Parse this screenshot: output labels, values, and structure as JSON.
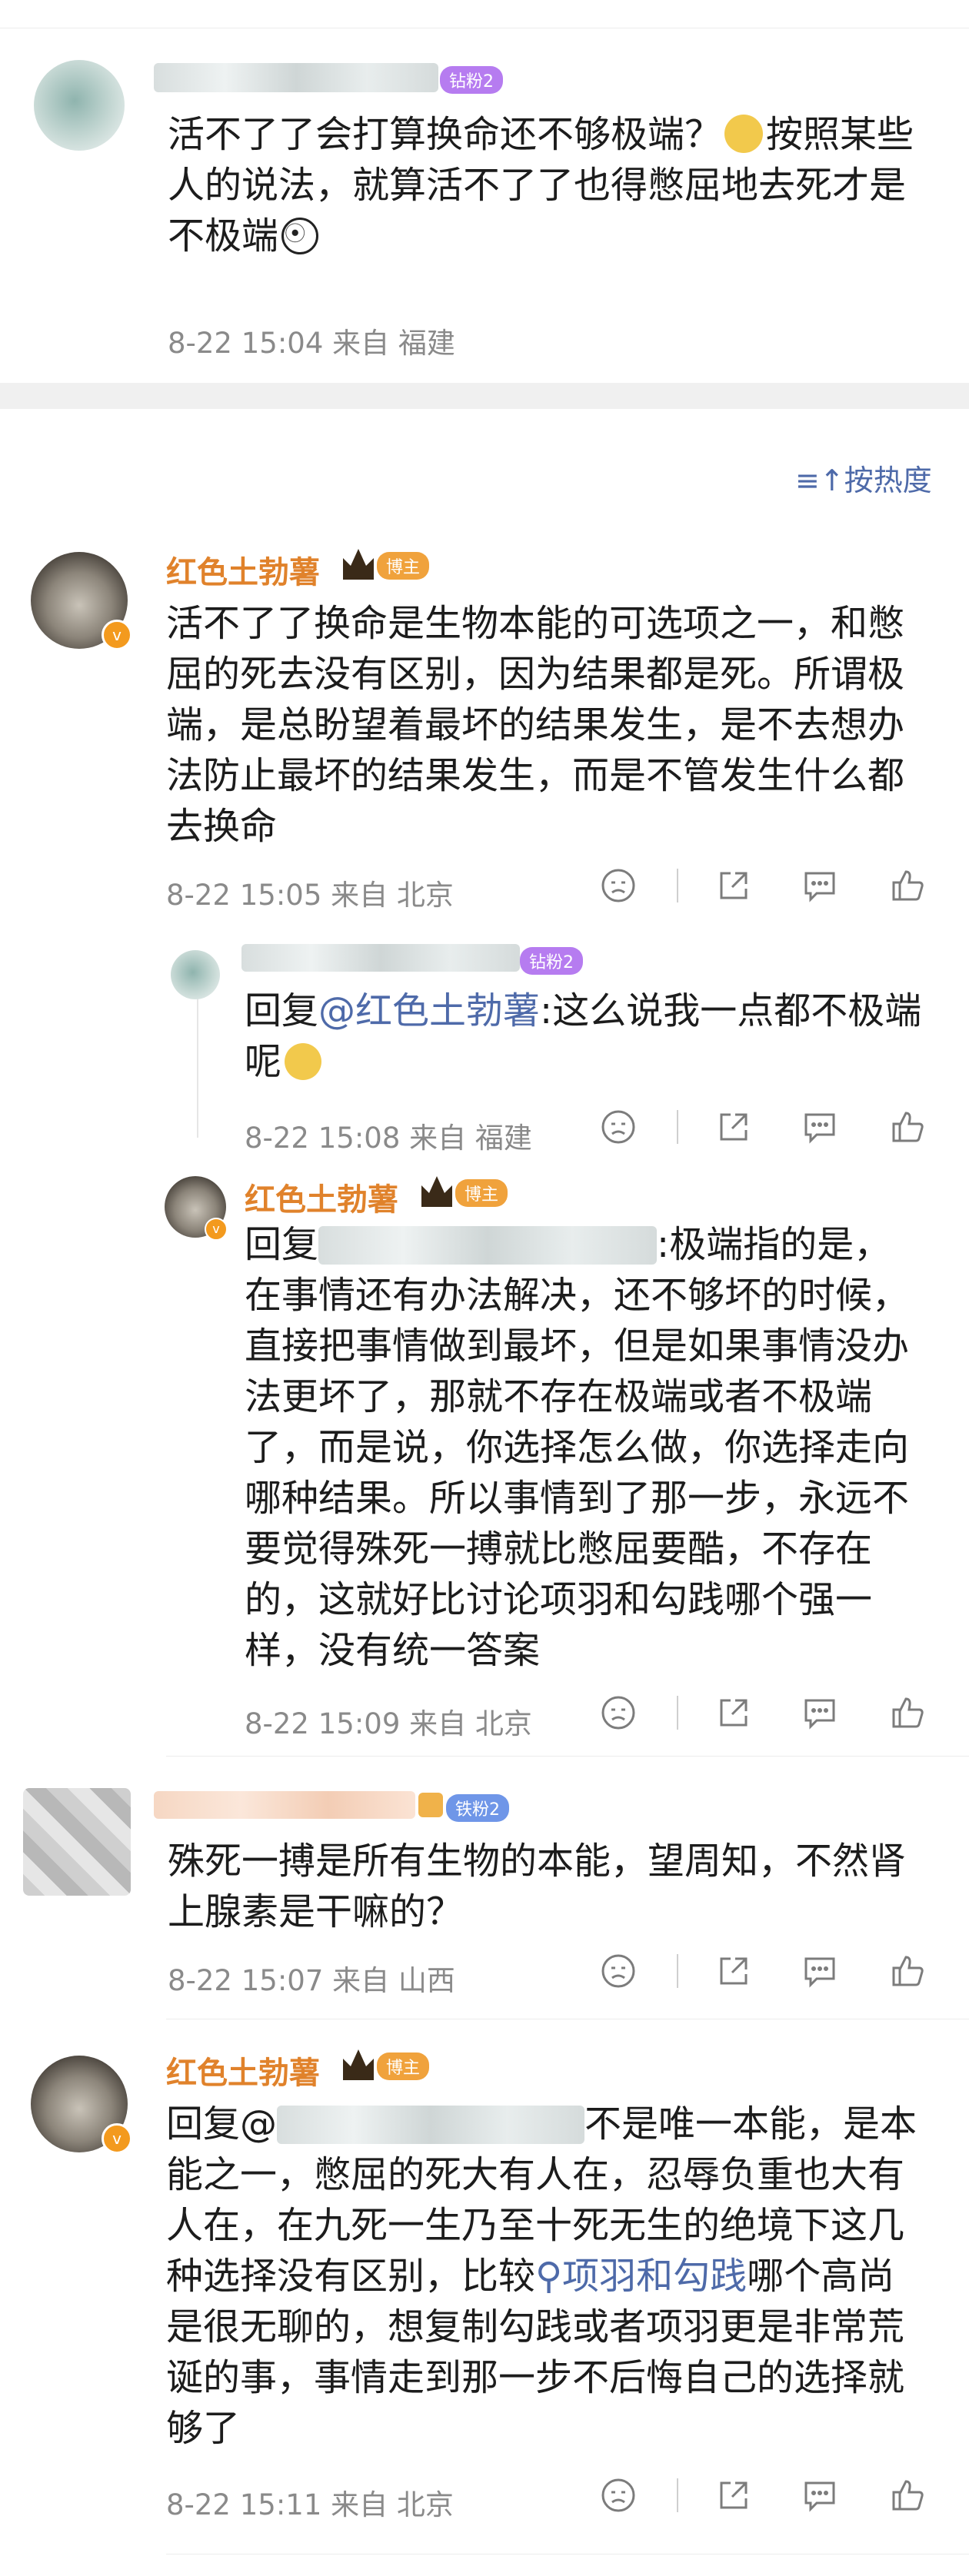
{
  "comment1": {
    "badge": "钻粉2",
    "text_pre": "活不了了会打算换命还不够极端？",
    "text_mid": "按照某些人的说法，就算活不了了也得憋屈地去死才是不极端",
    "meta": "8-22 15:04 来自 福建"
  },
  "sort_label": "按热度",
  "comment2": {
    "name": "红色土勃薯",
    "badge": "博主",
    "text": "活不了了换命是生物本能的可选项之一，和憋屈的死去没有区别，因为结果都是死。所谓极端，是总盼望着最坏的结果发生，是不去想办法防止最坏的结果发生，而是不管发生什么都去换命",
    "meta": "8-22 15:05 来自 北京"
  },
  "reply1": {
    "badge": "钻粉2",
    "reply_prefix": "回复",
    "mention": "@红色土勃薯",
    "text": ":这么说我一点都不极端呢",
    "meta": "8-22 15:08 来自 福建"
  },
  "reply2": {
    "name": "红色土勃薯",
    "badge": "博主",
    "reply_prefix": "回复",
    "text_tail": ":极端指的是，",
    "text": "在事情还有办法解决，还不够坏的时候，直接把事情做到最坏，但是如果事情没办法更坏了，那就不存在极端或者不极端了，而是说，你选择怎么做，你选择走向哪种结果。所以事情到了那一步，永远不要觉得殊死一搏就比憋屈要酷，不存在的，这就好比讨论项羽和勾践哪个强一样，没有统一答案",
    "meta": "8-22 15:09 来自 北京"
  },
  "comment3": {
    "badge": "铁粉2",
    "text": "殊死一搏是所有生物的本能，望周知，不然肾上腺素是干嘛的？",
    "meta": "8-22 15:07 来自 山西"
  },
  "comment4": {
    "name": "红色土勃薯",
    "badge": "博主",
    "reply_prefix": "回复@",
    "text_line1_tail": "不是唯一本能，是本",
    "text_body1": "能之一，憋屈的死大有人在，忍辱负重也大有人在，在九死一生乃至十死无生的绝境下这几种选择没有区别，比较",
    "topic": "项羽和勾践",
    "text_body2": "哪个高尚是很无聊的，想复制勾践或者项羽更是非常荒诞的事，事情走到那一步不后悔自己的选择就够了",
    "meta": "8-22 15:11 来自 北京"
  },
  "colors": {
    "accent_name": "#e0822b",
    "mention": "#4e6aa9",
    "diamond_badge": "#b67cf0",
    "iron_badge": "#6f96e8",
    "blogger_badge": "#f0a23c"
  }
}
